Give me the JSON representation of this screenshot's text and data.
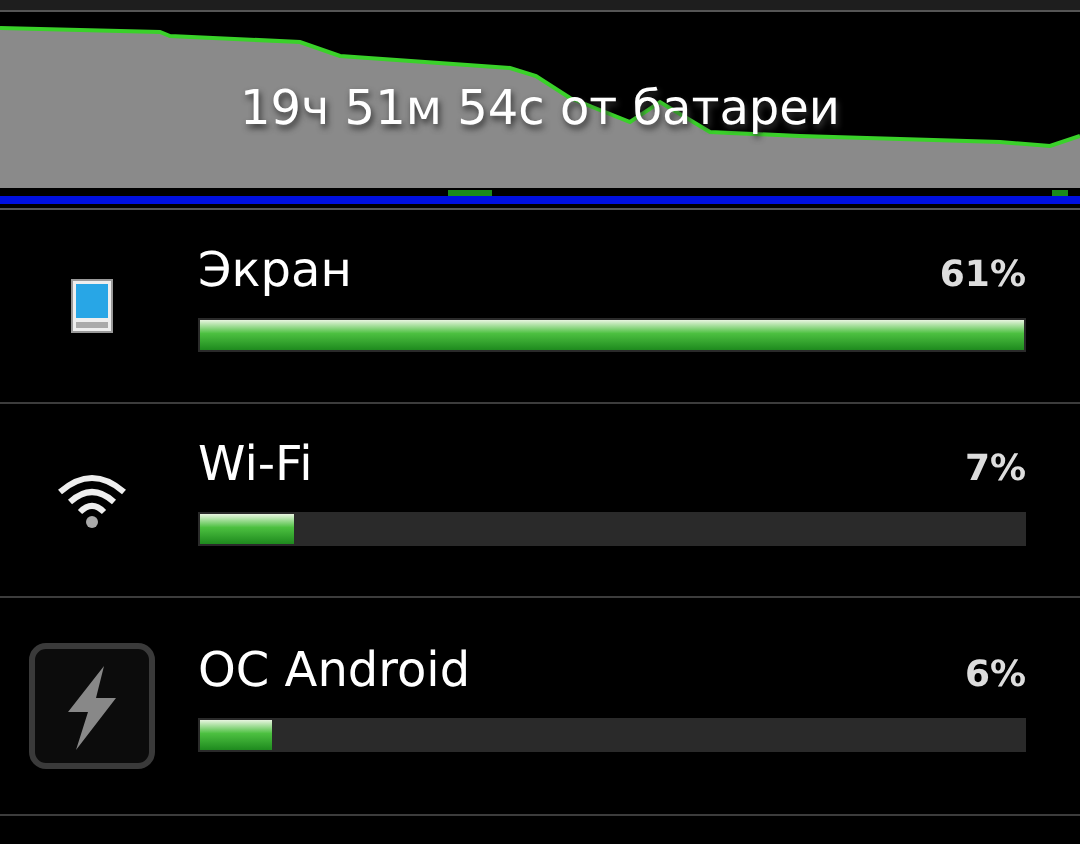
{
  "graph": {
    "caption": "19ч 51м 54с от батареи"
  },
  "items": [
    {
      "kind": "screen",
      "label": "Экран",
      "percent": "61%",
      "level": 1.0
    },
    {
      "kind": "wifi",
      "label": "Wi-Fi",
      "percent": "7%",
      "level": 0.115
    },
    {
      "kind": "android",
      "label": "ОС Android",
      "percent": "6%",
      "level": 0.087
    }
  ]
}
